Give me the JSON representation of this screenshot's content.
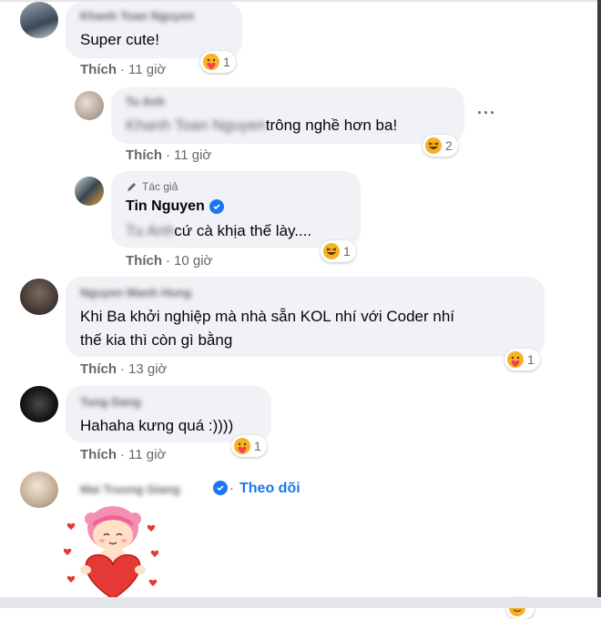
{
  "comments": [
    {
      "author": "Khanh Toan Nguyen",
      "text": "Super cute!",
      "like_label": "Thích",
      "time": "11 giờ",
      "reaction_count": "1",
      "reaction": "care"
    },
    {
      "author": "Tu Anh",
      "mention": "Khanh Toan Nguyen",
      "text": "trông nghề hơn ba!",
      "like_label": "Thích",
      "time": "11 giờ",
      "reaction_count": "2",
      "reaction": "haha",
      "more_label": "···"
    },
    {
      "badge": "Tác giả",
      "author": "Tin Nguyen",
      "mention": "Tu Anh",
      "text": "cứ cà khịa thế lày....",
      "like_label": "Thích",
      "time": "10 giờ",
      "reaction_count": "1",
      "reaction": "haha"
    },
    {
      "author": "Nguyen Manh Hung",
      "text_line1": "Khi Ba khởi nghiệp mà nhà sẵn KOL nhí với Coder nhí",
      "text_line2": "thế kia thì còn gì bằng",
      "like_label": "Thích",
      "time": "13 giờ",
      "reaction_count": "1",
      "reaction": "care"
    },
    {
      "author": "Tung Dang",
      "text": "Hahaha kưng quá :))))",
      "like_label": "Thích",
      "time": "11 giờ",
      "reaction_count": "1",
      "reaction": "care"
    },
    {
      "author": "Mai Truong Giang",
      "follow_label": "Theo dõi",
      "sticker": "heart-hug-sticker"
    }
  ],
  "colors": {
    "bubble": "#f0f2f5",
    "meta": "#65676b",
    "accent": "#1877f2",
    "care": "#f7b125",
    "heart": "#f33e58"
  }
}
